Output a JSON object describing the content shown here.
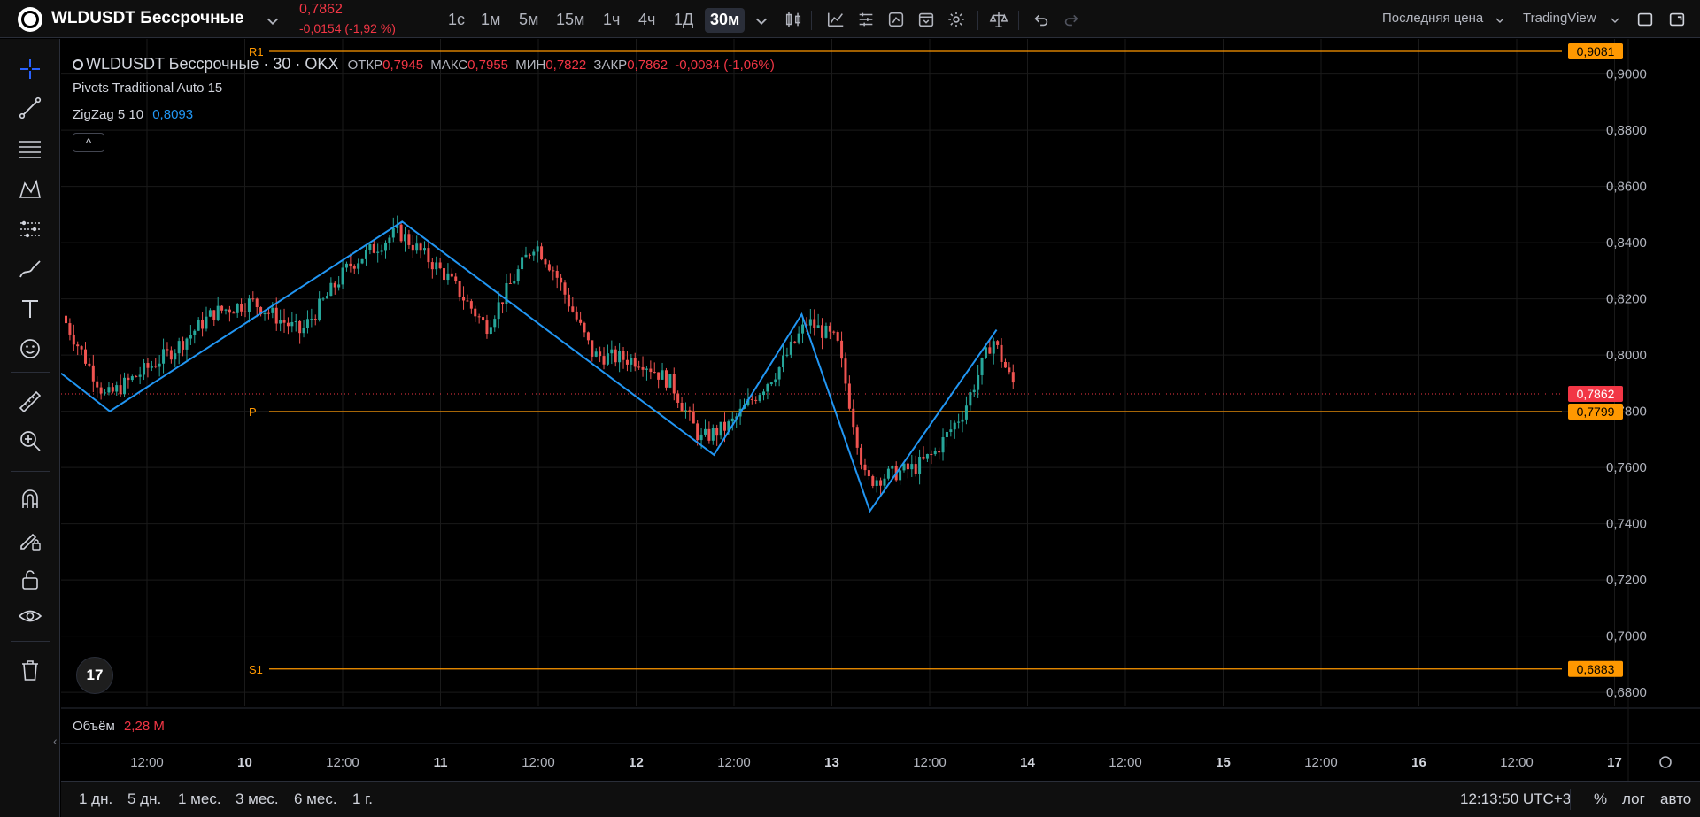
{
  "header": {
    "symbol": "WLDUSDT Бессрочные",
    "price": "0,7862",
    "change": "-0,0154 (-1,92 %)",
    "timeframes": [
      "1с",
      "1м",
      "5м",
      "15м",
      "1ч",
      "4ч",
      "1Д",
      "30м"
    ],
    "active_timeframe": "30м",
    "price_type": "Последняя цена",
    "data_source": "TradingView"
  },
  "legend": {
    "title": "WLDUSDT Бессрочные · 30 · OKX",
    "open_label": "ОТКР",
    "open": "0,7945",
    "high_label": "МАКС",
    "high": "0,7955",
    "low_label": "МИН",
    "low": "0,7822",
    "close_label": "ЗАКР",
    "close": "0,7862",
    "change": "-0,0084 (-1,06%)",
    "pivots": "Pivots Traditional Auto 15",
    "zigzag": "ZigZag 5 10",
    "zigzag_value": "0,8093",
    "collapse": "^"
  },
  "volume": {
    "label": "Объём",
    "value": "2,28 M"
  },
  "bottom": {
    "ranges": [
      "1 дн.",
      "5 дн.",
      "1 мес.",
      "3 мес.",
      "6 мес.",
      "1 г."
    ],
    "time": "12:13:50 UTC+3",
    "percent": "%",
    "log": "лог",
    "auto": "авто"
  },
  "badge": "17",
  "colors": {
    "up": "#26a69a",
    "down": "#ef5350",
    "zigzag": "#2196f3",
    "pivot": "#ff9800",
    "last_price": "#f23645"
  },
  "chart_data": {
    "type": "candlestick",
    "y_axis": {
      "ylim": [
        0.675,
        0.9125
      ],
      "ticks": [
        "0,9000",
        "0,8800",
        "0,8600",
        "0,8400",
        "0,8200",
        "0,8000",
        "0,7800",
        "0,7600",
        "0,7400",
        "0,7200",
        "0,7000",
        "0,6800"
      ]
    },
    "x_axis": {
      "ticks": [
        {
          "label": "12:00",
          "bold": false
        },
        {
          "label": "10",
          "bold": true
        },
        {
          "label": "12:00",
          "bold": false
        },
        {
          "label": "11",
          "bold": true
        },
        {
          "label": "12:00",
          "bold": false
        },
        {
          "label": "12",
          "bold": true
        },
        {
          "label": "12:00",
          "bold": false
        },
        {
          "label": "13",
          "bold": true
        },
        {
          "label": "12:00",
          "bold": false
        },
        {
          "label": "14",
          "bold": true
        },
        {
          "label": "12:00",
          "bold": false
        },
        {
          "label": "15",
          "bold": true
        },
        {
          "label": "12:00",
          "bold": false
        },
        {
          "label": "16",
          "bold": true
        },
        {
          "label": "12:00",
          "bold": false
        },
        {
          "label": "17",
          "bold": true
        }
      ]
    },
    "pivot_levels": [
      {
        "name": "R1",
        "value": 0.9081,
        "label": "0,9081"
      },
      {
        "name": "P",
        "value": 0.7799,
        "label": "0,7799"
      },
      {
        "name": "S1",
        "value": 0.6883,
        "label": "0,6883"
      }
    ],
    "last_price": {
      "value": 0.7862,
      "label": "0,7862"
    },
    "zigzag_points": [
      {
        "x": 0.0,
        "y": 0.7935
      },
      {
        "x": 0.5,
        "y": 0.78
      },
      {
        "x": 3.5,
        "y": 0.8475
      },
      {
        "x": 6.7,
        "y": 0.7645
      },
      {
        "x": 7.6,
        "y": 0.8145
      },
      {
        "x": 8.3,
        "y": 0.7445
      },
      {
        "x": 9.6,
        "y": 0.809
      }
    ],
    "price_path": [
      {
        "x": 0.05,
        "y": 0.814
      },
      {
        "x": 0.5,
        "y": 0.785
      },
      {
        "x": 1.2,
        "y": 0.802
      },
      {
        "x": 1.6,
        "y": 0.815
      },
      {
        "x": 2.0,
        "y": 0.819
      },
      {
        "x": 2.5,
        "y": 0.808
      },
      {
        "x": 3.0,
        "y": 0.832
      },
      {
        "x": 3.5,
        "y": 0.844
      },
      {
        "x": 4.0,
        "y": 0.828
      },
      {
        "x": 4.4,
        "y": 0.81
      },
      {
        "x": 4.9,
        "y": 0.84
      },
      {
        "x": 5.1,
        "y": 0.83
      },
      {
        "x": 5.5,
        "y": 0.8
      },
      {
        "x": 6.0,
        "y": 0.798
      },
      {
        "x": 6.3,
        "y": 0.79
      },
      {
        "x": 6.6,
        "y": 0.77
      },
      {
        "x": 6.9,
        "y": 0.775
      },
      {
        "x": 7.4,
        "y": 0.795
      },
      {
        "x": 7.7,
        "y": 0.812
      },
      {
        "x": 8.0,
        "y": 0.805
      },
      {
        "x": 8.3,
        "y": 0.755
      },
      {
        "x": 8.8,
        "y": 0.76
      },
      {
        "x": 9.0,
        "y": 0.765
      },
      {
        "x": 9.3,
        "y": 0.78
      },
      {
        "x": 9.6,
        "y": 0.806
      },
      {
        "x": 9.8,
        "y": 0.79
      }
    ]
  }
}
